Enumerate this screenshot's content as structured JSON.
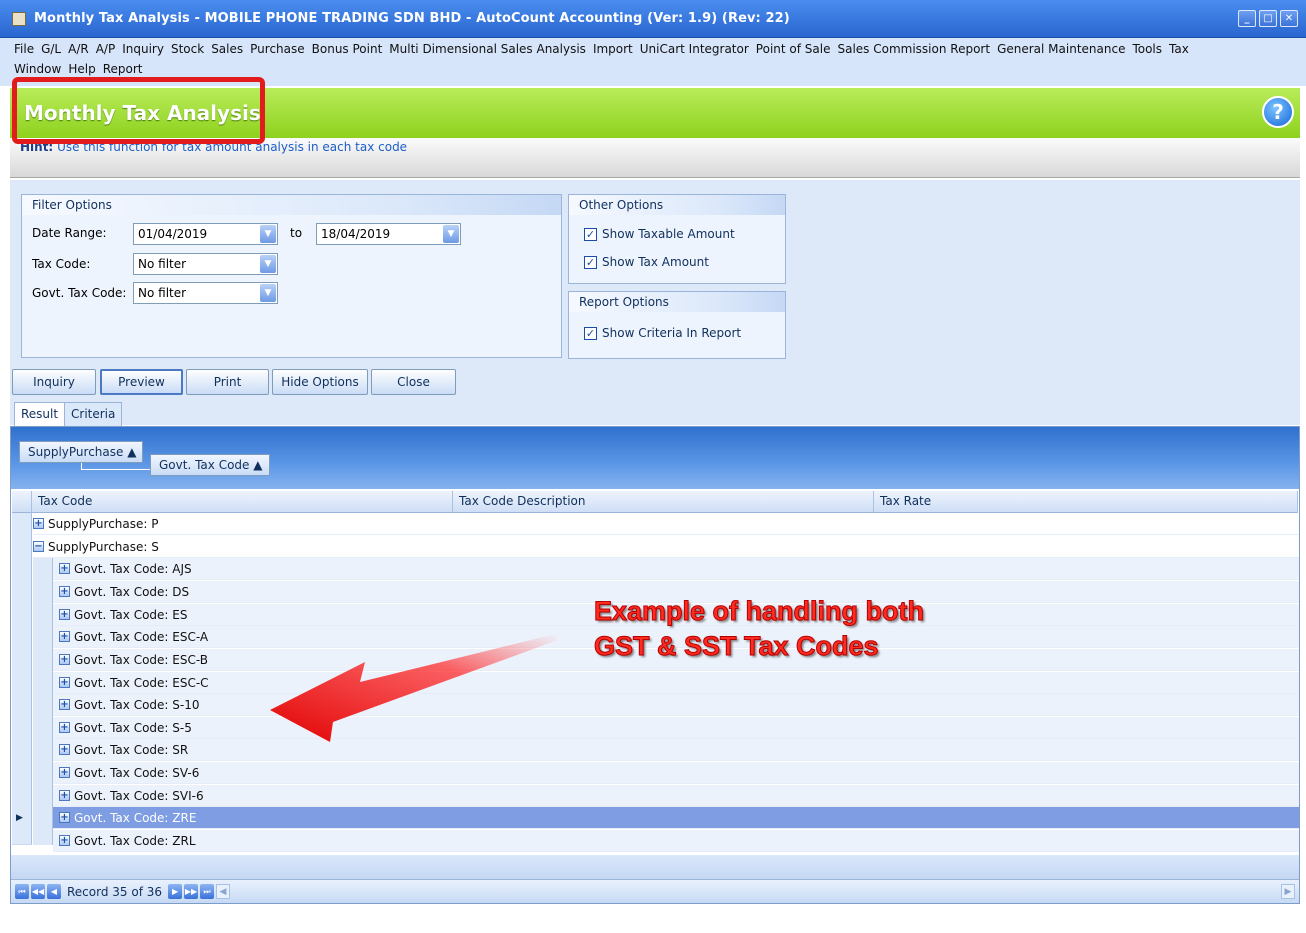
{
  "window": {
    "title": "Monthly Tax Analysis - MOBILE PHONE TRADING SDN BHD - AutoCount Accounting (Ver: 1.9) (Rev: 22)"
  },
  "menu": {
    "row1": [
      "File",
      "G/L",
      "A/R",
      "A/P",
      "Inquiry",
      "Stock",
      "Sales",
      "Purchase",
      "Bonus Point",
      "Multi Dimensional Sales Analysis",
      "Import",
      "UniCart Integrator",
      "Point of Sale",
      "Sales Commission Report",
      "General Maintenance",
      "Tools",
      "Tax"
    ],
    "row2": [
      "Window",
      "Help",
      "Report"
    ]
  },
  "header": {
    "title": "Monthly Tax Analysis",
    "hint_label": "Hint:",
    "hint_text": "Use this function for tax amount analysis in each tax code"
  },
  "filter": {
    "title": "Filter Options",
    "date_range_label": "Date Range:",
    "date_from": "01/04/2019",
    "to_label": "to",
    "date_to": "18/04/2019",
    "tax_code_label": "Tax Code:",
    "tax_code_value": "No filter",
    "govt_tax_code_label": "Govt. Tax Code:",
    "govt_tax_code_value": "No filter"
  },
  "other_options": {
    "title": "Other Options",
    "show_taxable": "Show Taxable Amount",
    "show_tax": "Show Tax Amount"
  },
  "report_options": {
    "title": "Report Options",
    "show_criteria": "Show Criteria In Report"
  },
  "buttons": {
    "inquiry": "Inquiry",
    "preview": "Preview",
    "print": "Print",
    "hide_options": "Hide Options",
    "close": "Close"
  },
  "tabs": {
    "result": "Result",
    "criteria": "Criteria"
  },
  "grid": {
    "group_by_1": "SupplyPurchase",
    "group_by_2": "Govt. Tax Code",
    "columns": [
      "Tax Code",
      "Tax Code Description",
      "Tax Rate"
    ],
    "rows": [
      "SupplyPurchase: P",
      "SupplyPurchase: S",
      "Govt. Tax Code: AJS",
      "Govt. Tax Code: DS",
      "Govt. Tax Code: ES",
      "Govt. Tax Code: ESC-A",
      "Govt. Tax Code: ESC-B",
      "Govt. Tax Code: ESC-C",
      "Govt. Tax Code: S-10",
      "Govt. Tax Code: S-5",
      "Govt. Tax Code: SR",
      "Govt. Tax Code: SV-6",
      "Govt. Tax Code: SVI-6",
      "Govt. Tax Code: ZRE",
      "Govt. Tax Code: ZRL"
    ],
    "record_text": "Record 35 of 36"
  },
  "annotation": {
    "line1": "Example of handling both",
    "line2": "GST & SST Tax Codes"
  },
  "colors": {
    "annotation_red": "#ff2a20",
    "header_green": "#8ed11d",
    "selected_row": "#7e9de3"
  }
}
